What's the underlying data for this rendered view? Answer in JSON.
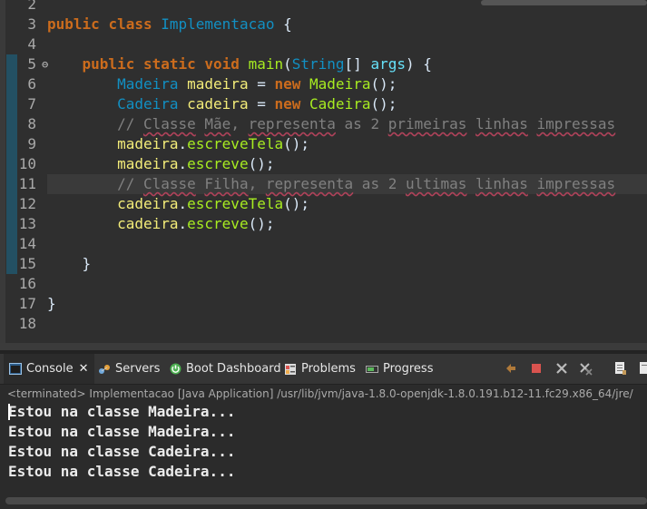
{
  "editor": {
    "lines": [
      {
        "n": "2"
      },
      {
        "n": "3"
      },
      {
        "n": "4"
      },
      {
        "n": "5"
      },
      {
        "n": "6"
      },
      {
        "n": "7"
      },
      {
        "n": "8"
      },
      {
        "n": "9"
      },
      {
        "n": "10"
      },
      {
        "n": "11"
      },
      {
        "n": "12"
      },
      {
        "n": "13"
      },
      {
        "n": "14"
      },
      {
        "n": "15"
      },
      {
        "n": "16"
      },
      {
        "n": "17"
      },
      {
        "n": "18"
      }
    ],
    "fold_marker": "⊖",
    "code": {
      "l3": {
        "kw1": "public",
        "kw2": "class",
        "cls": "Implementacao",
        "rest": " {"
      },
      "l5": {
        "kw1": "public",
        "kw2": "static",
        "kw3": "void",
        "mth": "main",
        "p1": "(",
        "cls": "String",
        "p2": "[] ",
        "arg": "args",
        "p3": ") {"
      },
      "l6": {
        "cls1": "Madeira",
        "var": "madeira",
        "eq": " = ",
        "kw": "new",
        "cls2": "Madeira",
        "end": "();"
      },
      "l7": {
        "cls1": "Cadeira",
        "var": "cadeira",
        "eq": " = ",
        "kw": "new",
        "cls2": "Cadeira",
        "end": "();"
      },
      "l8": {
        "comment_lead": "// ",
        "w1": "Classe",
        "w2": "Mãe",
        "c1": ", ",
        "w3": "representa",
        "c2": " as 2 ",
        "w4": "primeiras",
        "c3": " ",
        "w5": "linhas",
        "c4": " ",
        "w6": "impressas"
      },
      "l9": {
        "var": "madeira",
        "dot": ".",
        "mth": "escreveTela",
        "end": "();"
      },
      "l10": {
        "var": "madeira",
        "dot": ".",
        "mth": "escreve",
        "end": "();"
      },
      "l11": {
        "comment_lead": "// ",
        "w1": "Classe",
        "w2": "Filha",
        "c1": ", ",
        "w3": "representa",
        "c2": " as 2 ",
        "w4": "ultimas",
        "c3": " ",
        "w5": "linhas",
        "c4": " ",
        "w6": "impressas"
      },
      "l12": {
        "var": "cadeira",
        "dot": ".",
        "mth": "escreveTela",
        "end": "();"
      },
      "l13": {
        "var": "cadeira",
        "dot": ".",
        "mth": "escreve",
        "end": "();"
      },
      "l15": {
        "brace": "}"
      },
      "l17": {
        "brace": "}"
      }
    }
  },
  "console": {
    "tabs": [
      {
        "label": "Console",
        "icon": "console-icon",
        "active": true,
        "close": "✕"
      },
      {
        "label": "Servers",
        "icon": "servers-icon"
      },
      {
        "label": "Boot Dashboard",
        "icon": "boot-dashboard-icon"
      },
      {
        "label": "Problems",
        "icon": "problems-icon"
      },
      {
        "label": "Progress",
        "icon": "progress-icon"
      }
    ],
    "status": "<terminated> Implementacao [Java Application] /usr/lib/jvm/java-1.8.0-openjdk-1.8.0.191.b12-11.fc29.x86_64/jre/",
    "output": [
      "Estou na classe Madeira...",
      "Estou na classe Madeira...",
      "Estou na classe Cadeira...",
      "Estou na classe Cadeira..."
    ]
  },
  "colors": {
    "keyword": "#cc6c1d",
    "class": "#1290c3",
    "variable": "#f3ec79",
    "method": "#a7ec21",
    "comment": "#808080"
  }
}
